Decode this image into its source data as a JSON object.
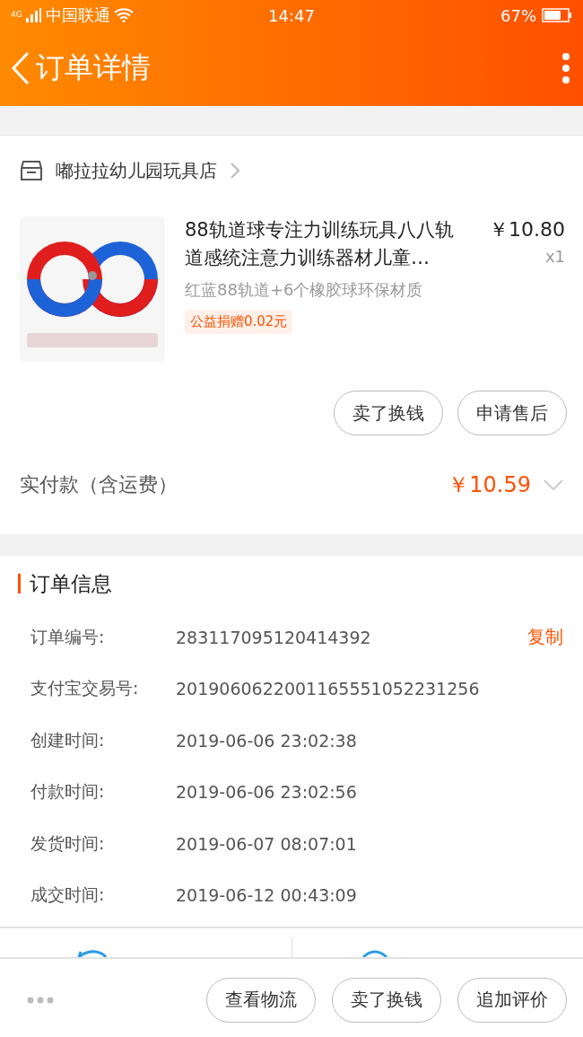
{
  "status_bar": {
    "network": "4G",
    "carrier": "中国联通",
    "time": "14:47",
    "battery": "67%"
  },
  "header": {
    "title": "订单详情"
  },
  "shop": {
    "name": "嘟拉拉幼儿园玩具店"
  },
  "product": {
    "kind": "picture",
    "title": "88轨道球专注力训练玩具八八轨道感统注意力训练器材儿童…",
    "price": "￥10.80",
    "quantity": "x1",
    "spec": "红蓝88轨道+6个橡胶球环保材质",
    "tag": "公益捐赠0.02元"
  },
  "item_buttons": [
    "卖了换钱",
    "申请售后"
  ],
  "total": {
    "label": "实付款（含运费）",
    "amount": "￥10.59"
  },
  "order_info": {
    "title": "订单信息",
    "copy": "复制",
    "rows": [
      {
        "label": "订单编号:",
        "value": "283117095120414392"
      },
      {
        "label": "支付宝交易号:",
        "value": "2019060622001165551052231256"
      },
      {
        "label": "创建时间:",
        "value": "2019-06-06 23:02:38"
      },
      {
        "label": "付款时间:",
        "value": "2019-06-06 23:02:56"
      },
      {
        "label": "发货时间:",
        "value": "2019-06-07 08:07:01"
      },
      {
        "label": "成交时间:",
        "value": "2019-06-12 00:43:09"
      }
    ]
  },
  "bottom_buttons": [
    "查看物流",
    "卖了换钱",
    "追加评价"
  ]
}
